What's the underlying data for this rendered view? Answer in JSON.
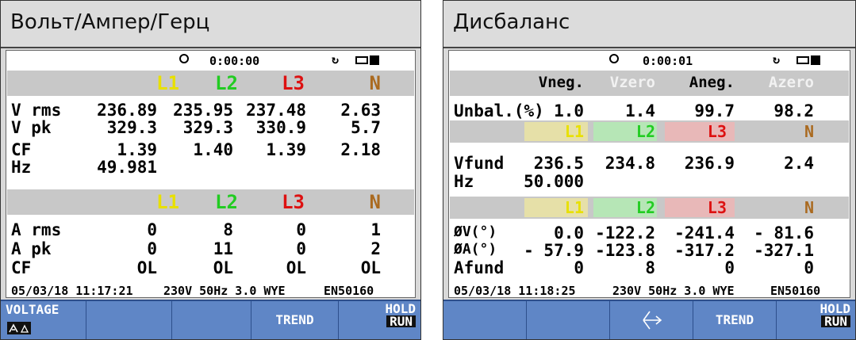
{
  "colors": {
    "l1": "#e8e000",
    "l2": "#22cc22",
    "l3": "#dd1111",
    "n": "#aa6a20",
    "softkey": "#5f86c6"
  },
  "screen1": {
    "title": "Вольт/Ампер/Герц",
    "status_time": "0:00:00",
    "phase_headers": [
      "L1",
      "L2",
      "L3",
      "N"
    ],
    "voltage_rows": [
      {
        "label": "V rms",
        "values": [
          "236.89",
          "235.95",
          "237.48",
          "2.63"
        ]
      },
      {
        "label": "V pk",
        "values": [
          "329.3",
          "329.3",
          "330.9",
          "5.7"
        ]
      },
      {
        "label": "CF",
        "values": [
          "1.39",
          "1.40",
          "1.39",
          "2.18"
        ]
      },
      {
        "label": "Hz",
        "values": [
          "49.981",
          "",
          "",
          ""
        ]
      }
    ],
    "current_rows": [
      {
        "label": "A rms",
        "values": [
          "0",
          "8",
          "0",
          "1"
        ]
      },
      {
        "label": "A pk",
        "values": [
          "0",
          "11",
          "0",
          "2"
        ]
      },
      {
        "label": "CF",
        "values": [
          "OL",
          "OL",
          "OL",
          "OL"
        ]
      }
    ],
    "footer": {
      "datetime": "05/03/18 11:17:21",
      "nominal": "230V  50Hz 3.0 WYE",
      "standard": "EN50160"
    },
    "softkeys": {
      "voltage": "VOLTAGE",
      "trend": "TREND",
      "hold": "HOLD",
      "run": "RUN"
    }
  },
  "screen2": {
    "title": "Дисбаланс",
    "status_time": "0:00:01",
    "unbal_headers": [
      "Vneg.",
      "Vzero",
      "Aneg.",
      "Azero"
    ],
    "unbal_row": {
      "label": "Unbal.(%)",
      "values": [
        "1.0",
        "1.4",
        "99.7",
        "98.2"
      ]
    },
    "phase_headers": [
      "L1",
      "L2",
      "L3",
      "N"
    ],
    "vfund_row": {
      "label": "Vfund",
      "values": [
        "236.5",
        "234.8",
        "236.9",
        "2.4"
      ]
    },
    "hz_row": {
      "label": "Hz",
      "values": [
        "50.000",
        "",
        "",
        ""
      ]
    },
    "angle_rows": [
      {
        "label": "ØV(°)",
        "values": [
          "0.0",
          "-122.2",
          "-241.4",
          "- 81.6"
        ]
      },
      {
        "label": "ØA(°)",
        "values": [
          "- 57.9",
          "-123.8",
          "-317.2",
          "-327.1"
        ]
      },
      {
        "label": "Afund",
        "values": [
          "0",
          "8",
          "0",
          "0"
        ]
      }
    ],
    "footer": {
      "datetime": "05/03/18 11:18:25",
      "nominal": "230V  50Hz 3.0 WYE",
      "standard": "EN50160"
    },
    "softkeys": {
      "trend": "TREND",
      "hold": "HOLD",
      "run": "RUN"
    }
  }
}
